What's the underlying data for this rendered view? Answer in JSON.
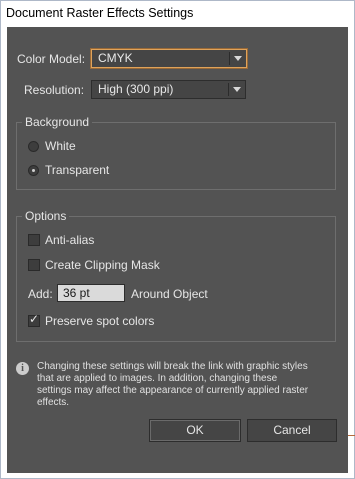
{
  "window": {
    "title": "Document Raster Effects Settings"
  },
  "color_model": {
    "label": "Color Model:",
    "value": "CMYK"
  },
  "resolution": {
    "label": "Resolution:",
    "value": "High (300 ppi)"
  },
  "background": {
    "title": "Background",
    "options": [
      {
        "label": "White",
        "selected": false
      },
      {
        "label": "Transparent",
        "selected": true
      }
    ]
  },
  "options": {
    "title": "Options",
    "anti_alias": {
      "label": "Anti-alias",
      "checked": false
    },
    "clipping_mask": {
      "label": "Create Clipping Mask",
      "checked": false
    },
    "add": {
      "label": "Add:",
      "value": "36 pt",
      "suffix": "Around Object"
    },
    "preserve_spot": {
      "label": "Preserve spot colors",
      "checked": true
    }
  },
  "info": {
    "icon": "info-icon",
    "text": "Changing these settings will break the link with graphic styles that are applied to images. In addition, changing these settings may affect the appearance of currently applied raster effects."
  },
  "buttons": {
    "ok": "OK",
    "cancel": "Cancel"
  },
  "colors": {
    "panel": "#535353",
    "focus": "#e0a35a"
  }
}
